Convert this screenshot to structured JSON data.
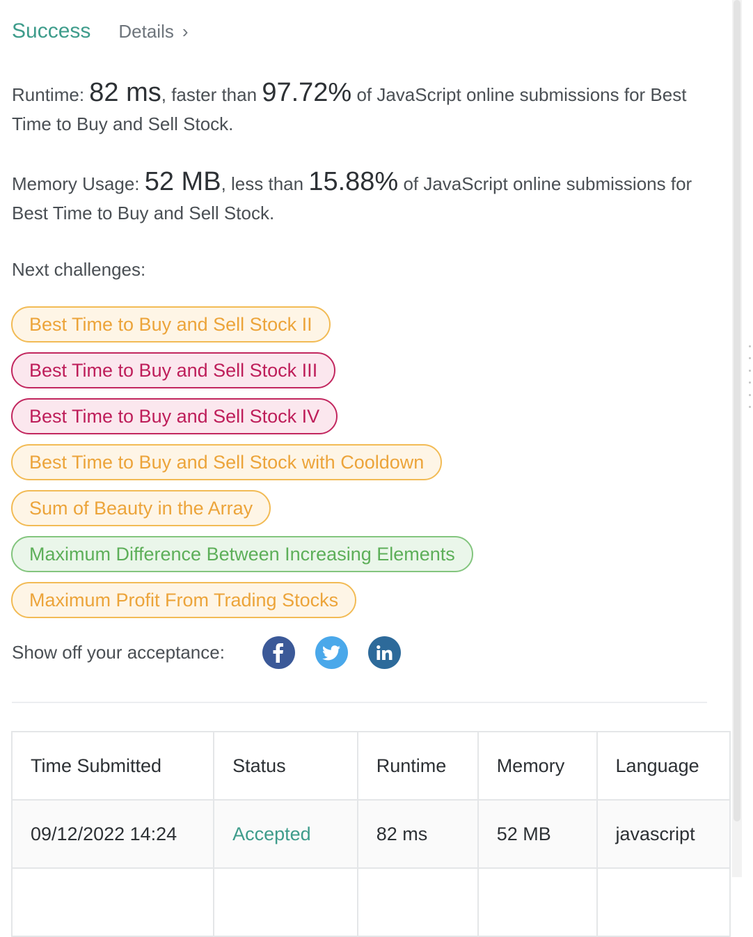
{
  "header": {
    "status": "Success",
    "details_label": "Details",
    "details_chevron": "›"
  },
  "runtime_stat": {
    "label": "Runtime:",
    "value": "82 ms",
    "comparison": ", faster than",
    "percent": "97.72%",
    "suffix": "of JavaScript online submissions for Best Time to Buy and Sell Stock."
  },
  "memory_stat": {
    "label": "Memory Usage:",
    "value": "52 MB",
    "comparison": ", less than",
    "percent": "15.88%",
    "suffix": "of JavaScript online submissions for Best Time to Buy and Sell Stock."
  },
  "next_challenges": {
    "label": "Next challenges:",
    "items": [
      {
        "title": "Best Time to Buy and Sell Stock II",
        "difficulty": "medium"
      },
      {
        "title": "Best Time to Buy and Sell Stock III",
        "difficulty": "hard"
      },
      {
        "title": "Best Time to Buy and Sell Stock IV",
        "difficulty": "hard"
      },
      {
        "title": "Best Time to Buy and Sell Stock with Cooldown",
        "difficulty": "medium"
      },
      {
        "title": "Sum of Beauty in the Array",
        "difficulty": "medium"
      },
      {
        "title": "Maximum Difference Between Increasing Elements",
        "difficulty": "easy"
      },
      {
        "title": "Maximum Profit From Trading Stocks",
        "difficulty": "medium"
      }
    ]
  },
  "share": {
    "label": "Show off your acceptance:",
    "icons": [
      "facebook-icon",
      "twitter-icon",
      "linkedin-icon"
    ]
  },
  "submissions": {
    "headers": [
      "Time Submitted",
      "Status",
      "Runtime",
      "Memory",
      "Language"
    ],
    "rows": [
      {
        "time": "09/12/2022 14:24",
        "status": "Accepted",
        "runtime": "82 ms",
        "memory": "52 MB",
        "language": "javascript"
      }
    ]
  },
  "colors": {
    "success": "#3e9c8b",
    "medium": "#eca43a",
    "hard": "#be1e5a",
    "easy": "#5daf59",
    "facebook": "#3b5998",
    "twitter": "#4aa8ea",
    "linkedin": "#2d6a9a"
  }
}
